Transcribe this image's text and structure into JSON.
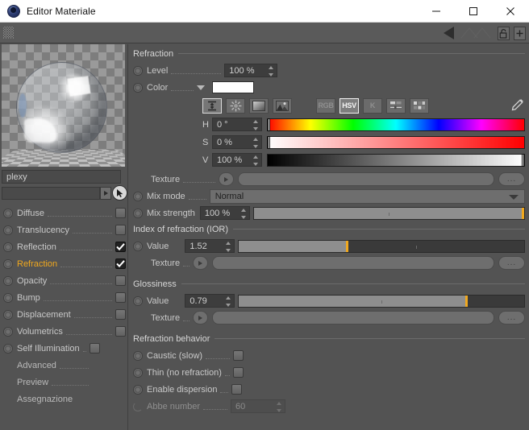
{
  "window": {
    "title": "Editor Materiale",
    "app_icon": "c4d-sphere-icon",
    "minimize": "minimize-icon",
    "maximize": "maximize-icon",
    "close": "close-icon"
  },
  "toolstrip": {
    "grip": "drag-grip",
    "back_arrow": "triangle-left-icon",
    "lock": "padlock-open-icon",
    "add_panel": "plus-box-icon"
  },
  "material": {
    "name": "plexy",
    "preview_alt": "glass-sphere-preview",
    "pick_field_value": "",
    "channels": [
      {
        "label": "Diffuse",
        "checked": false,
        "active": false
      },
      {
        "label": "Translucency",
        "checked": false,
        "active": false
      },
      {
        "label": "Reflection",
        "checked": true,
        "active": false
      },
      {
        "label": "Refraction",
        "checked": true,
        "active": true
      },
      {
        "label": "Opacity",
        "checked": false,
        "active": false
      },
      {
        "label": "Bump",
        "checked": false,
        "active": false
      },
      {
        "label": "Displacement",
        "checked": false,
        "active": false
      },
      {
        "label": "Volumetrics",
        "checked": false,
        "active": false
      },
      {
        "label": "Self Illumination",
        "checked": false,
        "active": false
      }
    ],
    "extra_items": [
      {
        "label": "Advanced"
      },
      {
        "label": "Preview"
      },
      {
        "label": "Assegnazione"
      }
    ]
  },
  "refraction": {
    "group_title": "Refraction",
    "level_label": "Level",
    "level_value": "100 %",
    "color_label": "Color",
    "color_swatch": "#ffffff",
    "picker_tools": [
      {
        "name": "eyedrop-range-icon",
        "selected": true
      },
      {
        "name": "color-wheel-icon",
        "selected": false
      },
      {
        "name": "gradient-square-icon",
        "selected": false
      },
      {
        "name": "image-picker-icon",
        "selected": false
      }
    ],
    "color_modes": [
      {
        "label": "RGB",
        "selected": false
      },
      {
        "label": "HSV",
        "selected": true
      },
      {
        "label": "K",
        "selected": false
      }
    ],
    "extra_mode_icons": [
      {
        "name": "sliders-icon"
      },
      {
        "name": "swatches-icon"
      }
    ],
    "eyedropper": "eyedropper-icon",
    "hsv": [
      {
        "label": "H",
        "value": "0 °",
        "handle_pct": 0
      },
      {
        "label": "S",
        "value": "0 %",
        "handle_pct": 0
      },
      {
        "label": "V",
        "value": "100 %",
        "handle_pct": 100
      }
    ],
    "texture_label": "Texture",
    "texture_value": "",
    "texture_browse": "...",
    "mix_mode_label": "Mix mode",
    "mix_mode_value": "Normal",
    "mix_strength_label": "Mix strength",
    "mix_strength_value": "100 %",
    "mix_strength_pct": 100
  },
  "ior": {
    "group_title": "Index of refraction (IOR)",
    "value_label": "Value",
    "value": "1.52",
    "value_pct": 38,
    "texture_label": "Texture",
    "texture_value": "",
    "texture_browse": "..."
  },
  "glossiness": {
    "group_title": "Glossiness",
    "value_label": "Value",
    "value": "0.79",
    "value_pct": 80,
    "texture_label": "Texture",
    "texture_value": "",
    "texture_browse": "..."
  },
  "behavior": {
    "group_title": "Refraction behavior",
    "items": [
      {
        "label": "Caustic (slow)",
        "checked": false,
        "disabled": false
      },
      {
        "label": "Thin (no refraction)",
        "checked": false,
        "disabled": false
      },
      {
        "label": "Enable dispersion",
        "checked": false,
        "disabled": false
      }
    ],
    "abbe_label": "Abbe number",
    "abbe_value": "60",
    "abbe_disabled": true
  },
  "colors": {
    "accent": "#f0a81e",
    "panel_bg": "#535353",
    "titlebar_bg": "#ffffff",
    "field_bg": "#3d3d3d"
  }
}
